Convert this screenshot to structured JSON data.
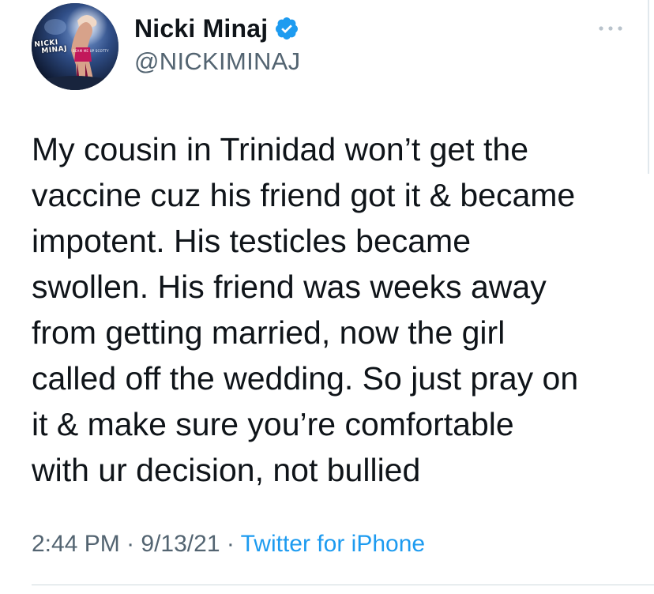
{
  "author": {
    "display_name": "Nicki Minaj",
    "handle": "@NICKIMINAJ",
    "avatar_logo_lines": [
      "NICKI",
      "MINAJ"
    ],
    "avatar_sub_text": "BEAM ME UP SCOTTY",
    "verified_icon": "verified-badge-icon"
  },
  "more_icon": "more-dots-icon",
  "tweet": {
    "lines": [
      "My cousin in Trinidad won’t get the",
      "vaccine cuz his friend got it & became",
      "impotent. His testicles became",
      "swollen. His friend was weeks away",
      "from getting married, now the girl",
      "called off the wedding. So just pray on",
      "it & make sure you’re comfortable",
      "with ur decision, not bullied"
    ]
  },
  "meta": {
    "time": "2:44 PM",
    "sep1": " · ",
    "date": "9/13/21",
    "sep2": " · ",
    "source": "Twitter for iPhone"
  },
  "colors": {
    "verified": "#1d9bf0",
    "link": "#1d9bf0",
    "text": "#0f1419",
    "muted": "#536471"
  }
}
